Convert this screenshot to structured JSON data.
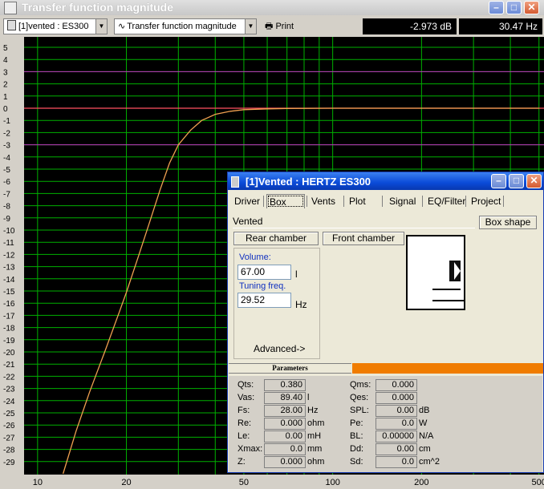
{
  "window": {
    "title": "Transfer function magnitude"
  },
  "toolbar": {
    "driver_select": "[1]vented : ES300",
    "view_select": "Transfer function magnitude",
    "view_icon": "wave-icon",
    "print_label": "Print",
    "readout_db": "-2.973 dB",
    "readout_hz": "30.47 Hz"
  },
  "chart_data": {
    "type": "line",
    "title": "",
    "xlabel": "",
    "ylabel": "",
    "x_scale": "log",
    "xlim": [
      9,
      520
    ],
    "ylim": [
      -30,
      6
    ],
    "x_ticks": [
      "10",
      "20",
      "50",
      "100",
      "200",
      "500"
    ],
    "y_ticks": [
      "5",
      "4",
      "3",
      "2",
      "1",
      "0",
      "-1",
      "-2",
      "-3",
      "-4",
      "-5",
      "-6",
      "-7",
      "-8",
      "-9",
      "-10",
      "-11",
      "-12",
      "-13",
      "-14",
      "-15",
      "-16",
      "-17",
      "-18",
      "-19",
      "-20",
      "-21",
      "-22",
      "-23",
      "-24",
      "-25",
      "-26",
      "-27",
      "-28",
      "-29"
    ],
    "grid": true,
    "reference_line_db": 0,
    "colors": {
      "background": "#000000",
      "grid": "#00b000",
      "curve": "#f0a050",
      "reference": "#ff5060",
      "guide": "#c030c0"
    },
    "series": [
      {
        "x": [
          12.2,
          13.5,
          15,
          17,
          19,
          20,
          22,
          24,
          26,
          28,
          30,
          33,
          36,
          40,
          45,
          50,
          60,
          70,
          80,
          100,
          150,
          200,
          300,
          500
        ],
        "y": [
          -30,
          -26.5,
          -23.3,
          -19.8,
          -16.6,
          -15.1,
          -12.1,
          -9.3,
          -6.7,
          -4.5,
          -3.0,
          -1.8,
          -1.0,
          -0.5,
          -0.25,
          -0.12,
          -0.05,
          -0.02,
          -0.01,
          0,
          0,
          0,
          0,
          0
        ]
      }
    ]
  },
  "dialog": {
    "title": "[1]Vented : HERTZ  ES300",
    "tabs": [
      "Driver",
      "Box",
      "Vents",
      "Plot",
      "Signal",
      "EQ/Filter",
      "Project"
    ],
    "box_type": "Vented",
    "box_shape_btn": "Box shape",
    "rear_chamber_btn": "Rear chamber",
    "front_chamber_btn": "Front chamber",
    "volume_label": "Volume:",
    "volume_value": "67.00",
    "volume_unit": "l",
    "tuning_label": "Tuning freq.",
    "tuning_value": "29.52",
    "tuning_unit": "Hz",
    "advanced_btn": "Advanced->",
    "params_header": "Parameters",
    "params_left": [
      {
        "label": "Qts:",
        "value": "0.380",
        "unit": ""
      },
      {
        "label": "Vas:",
        "value": "89.40",
        "unit": "l"
      },
      {
        "label": "Fs:",
        "value": "28.00",
        "unit": "Hz"
      },
      {
        "label": "Re:",
        "value": "0.000",
        "unit": "ohm"
      },
      {
        "label": "Le:",
        "value": "0.00",
        "unit": "mH"
      },
      {
        "label": "Xmax:",
        "value": "0.0",
        "unit": "mm"
      },
      {
        "label": "Z:",
        "value": "0.000",
        "unit": "ohm"
      }
    ],
    "params_right": [
      {
        "label": "Qms:",
        "value": "0.000",
        "unit": ""
      },
      {
        "label": "Qes:",
        "value": "0.000",
        "unit": ""
      },
      {
        "label": "SPL:",
        "value": "0.00",
        "unit": "dB"
      },
      {
        "label": "Pe:",
        "value": "0.0",
        "unit": "W"
      },
      {
        "label": "BL:",
        "value": "0.00000",
        "unit": "N/A"
      },
      {
        "label": "Dd:",
        "value": "0.00",
        "unit": "cm"
      },
      {
        "label": "Sd:",
        "value": "0.0",
        "unit": "cm^2"
      }
    ]
  }
}
